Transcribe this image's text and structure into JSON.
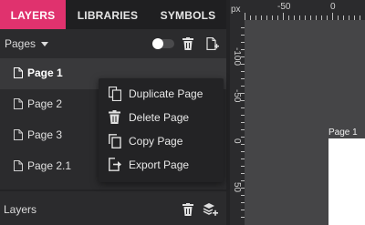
{
  "tabs": [
    {
      "label": "LAYERS",
      "active": true
    },
    {
      "label": "LIBRARIES",
      "active": false
    },
    {
      "label": "SYMBOLS",
      "active": false
    }
  ],
  "pages": {
    "label": "Pages",
    "list": [
      {
        "name": "Page 1",
        "selected": true
      },
      {
        "name": "Page 2",
        "selected": false
      },
      {
        "name": "Page 3",
        "selected": false
      },
      {
        "name": "Page 2.1",
        "selected": false
      }
    ]
  },
  "context_menu": {
    "items": [
      {
        "label": "Duplicate Page",
        "icon": "duplicate-icon"
      },
      {
        "label": "Delete Page",
        "icon": "trash-icon"
      },
      {
        "label": "Copy Page",
        "icon": "copy-icon"
      },
      {
        "label": "Export Page",
        "icon": "export-icon"
      }
    ]
  },
  "layers": {
    "label": "Layers"
  },
  "ruler": {
    "unit": "px",
    "top_ticks": [
      "-50",
      "0"
    ],
    "left_ticks": [
      "-100",
      "-50",
      "0",
      "50"
    ]
  },
  "canvas": {
    "artboard_label": "Page 1"
  },
  "colors": {
    "accent": "#e0326e",
    "panel": "#2b2b2d",
    "canvas": "#454547"
  }
}
